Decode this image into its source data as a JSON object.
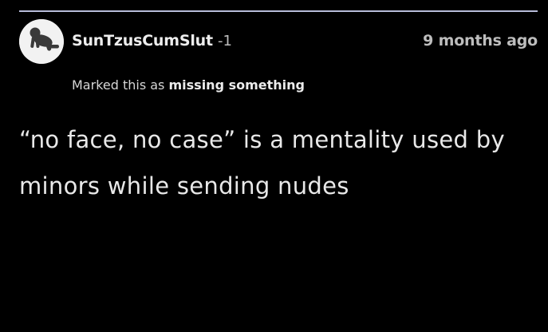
{
  "comment": {
    "author": {
      "username": "SunTzusCumSlut",
      "score": "-1",
      "avatar_icon": "crawling-baby-icon"
    },
    "timestamp": "9 months ago",
    "status": {
      "prefix": "Marked this as",
      "value": "missing something"
    },
    "body": "“no face, no case” is a mentality used by minors while sending nudes"
  },
  "colors": {
    "background": "#000000",
    "divider": "#b7bcd9",
    "avatar_bg": "#f2f2f2",
    "text_primary": "#e8e8e8",
    "text_secondary": "#bdbdbd"
  }
}
